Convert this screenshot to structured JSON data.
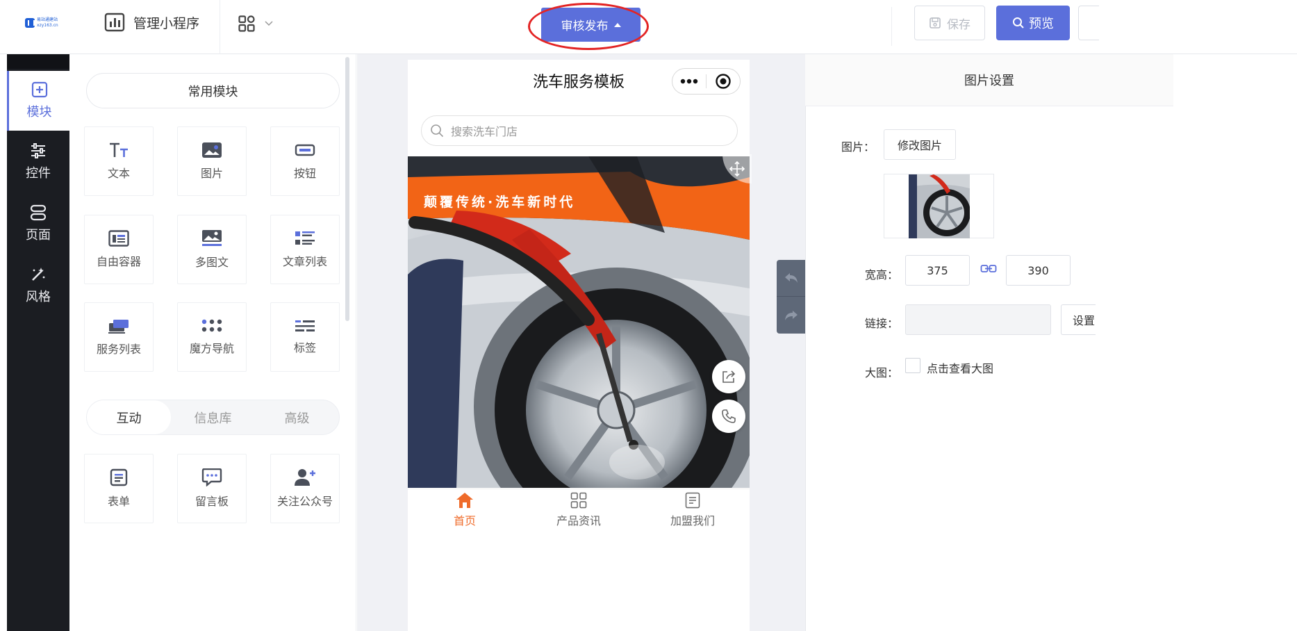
{
  "header": {
    "logo_text_1": "易站通建站",
    "logo_text_2": "xzy163.cn",
    "manage_label": "管理小程序",
    "publish_label": "审核发布",
    "save_label": "保存",
    "preview_label": "预览"
  },
  "leftnav": {
    "items": [
      {
        "label": "模块",
        "icon": "plus-square-icon"
      },
      {
        "label": "控件",
        "icon": "sliders-icon"
      },
      {
        "label": "页面",
        "icon": "pages-icon"
      },
      {
        "label": "风格",
        "icon": "magic-wand-icon"
      }
    ]
  },
  "palette": {
    "common_header": "常用模块",
    "common": [
      {
        "label": "文本",
        "icon": "text-icon"
      },
      {
        "label": "图片",
        "icon": "image-icon"
      },
      {
        "label": "按钮",
        "icon": "button-icon"
      },
      {
        "label": "自由容器",
        "icon": "container-icon"
      },
      {
        "label": "多图文",
        "icon": "multi-image-text-icon"
      },
      {
        "label": "文章列表",
        "icon": "article-list-icon"
      },
      {
        "label": "服务列表",
        "icon": "service-list-icon"
      },
      {
        "label": "魔方导航",
        "icon": "grid-nav-icon"
      },
      {
        "label": "标签",
        "icon": "tag-icon"
      }
    ],
    "tabs": [
      "互动",
      "信息库",
      "高级"
    ],
    "interactive": [
      {
        "label": "表单",
        "icon": "form-icon"
      },
      {
        "label": "留言板",
        "icon": "message-board-icon"
      },
      {
        "label": "关注公众号",
        "icon": "follow-account-icon"
      }
    ]
  },
  "phone": {
    "title": "洗车服务模板",
    "search_placeholder": "搜索洗车门店",
    "banner_text": "颠覆传统·洗车新时代",
    "tabbar": [
      {
        "label": "首页",
        "icon": "home-icon",
        "active": true
      },
      {
        "label": "产品资讯",
        "icon": "grid-icon",
        "active": false
      },
      {
        "label": "加盟我们",
        "icon": "document-icon",
        "active": false
      }
    ]
  },
  "settings": {
    "title": "图片设置",
    "image_label": "图片：",
    "change_image": "修改图片",
    "size_label": "宽高：",
    "width": "375",
    "height": "390",
    "link_label": "链接：",
    "link_value": "",
    "link_set": "设置",
    "bigimg_label": "大图：",
    "bigimg_check": "点击查看大图",
    "bigimg_checked": false
  },
  "colors": {
    "accent": "#5b6fdb",
    "nav_bg": "#1b1d22",
    "banner_orange": "#f26416",
    "active_tab": "#ef6b2a",
    "annotation_ring": "#e32424"
  }
}
